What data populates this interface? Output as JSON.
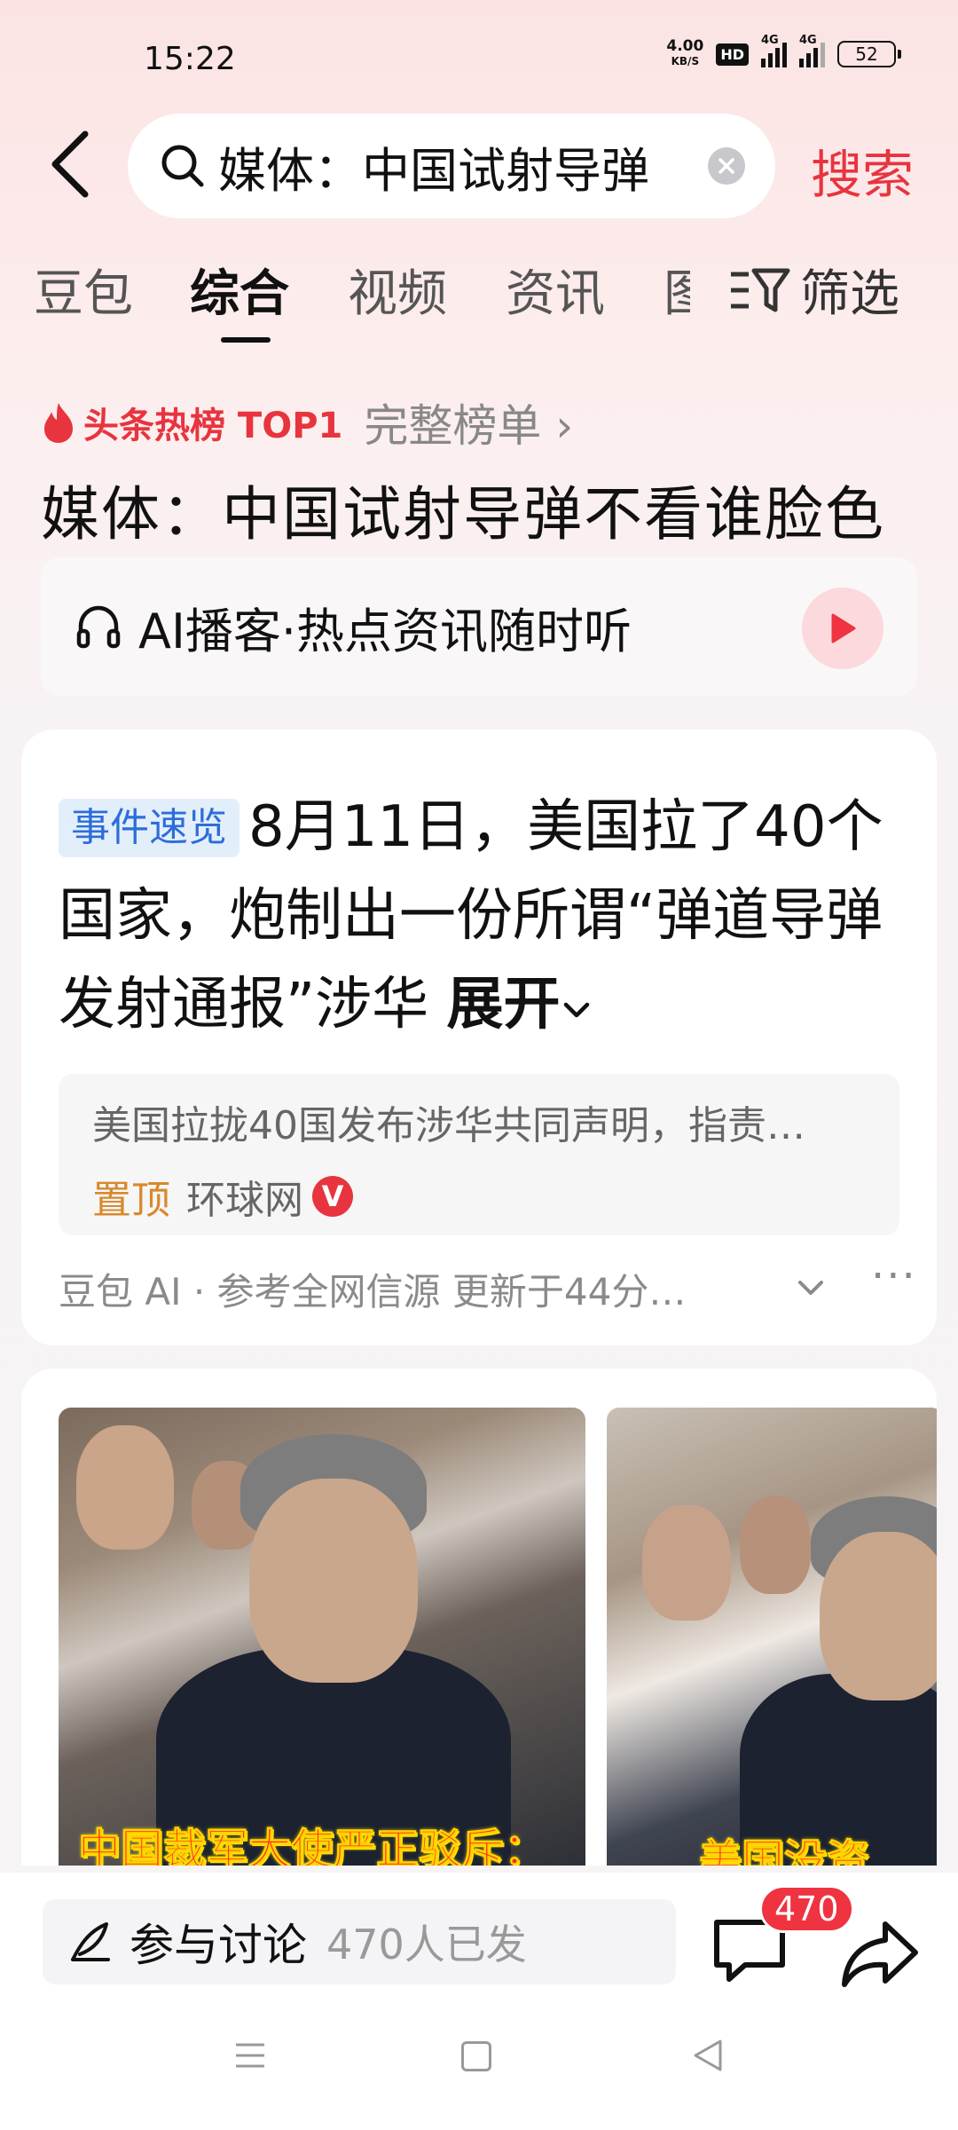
{
  "status_bar": {
    "time": "15:22",
    "net_speed_value": "4.00",
    "net_speed_unit": "KB/S",
    "hd_label": "HD",
    "signal1_label": "4G",
    "signal2_label": "4G",
    "battery": "52"
  },
  "search": {
    "query": "媒体：中国试射导弹",
    "submit_label": "搜索",
    "clear_icon": "close-icon",
    "back_icon": "chevron-left-icon"
  },
  "tabs": {
    "items": [
      "豆包",
      "综合",
      "视频",
      "资讯",
      "图"
    ],
    "active": "综合",
    "filter_label": "筛选"
  },
  "hot": {
    "label": "头条热榜 TOP1",
    "full_list": "完整榜单 ›",
    "headline": "媒体：中国试射导弹不看谁脸色"
  },
  "podcast": {
    "label": "AI播客·热点资讯随时听"
  },
  "summary_card": {
    "badge": "事件速览",
    "text": "8月11日，美国拉了40个国家，炮制出一份所谓“弹道导弹发射通报”涉华",
    "expand": "展开",
    "source_title": "美国拉拢40国发布涉华共同声明，指责…",
    "pinned": "置顶",
    "source_name": "环球网",
    "verified_badge": "V",
    "footer": "豆包 AI · 参考全网信源 更新于44分…",
    "more": "···"
  },
  "media": {
    "caption1": "中国裁军大使严正驳斥：",
    "caption2": "美国没资"
  },
  "bottom_bar": {
    "discuss_label": "参与讨论",
    "discuss_count": "470人已发",
    "comment_count": "470"
  },
  "colors": {
    "accent_red": "#e8343f",
    "badge_blue": "#2c6ed8",
    "pinned_orange": "#d8892b"
  }
}
